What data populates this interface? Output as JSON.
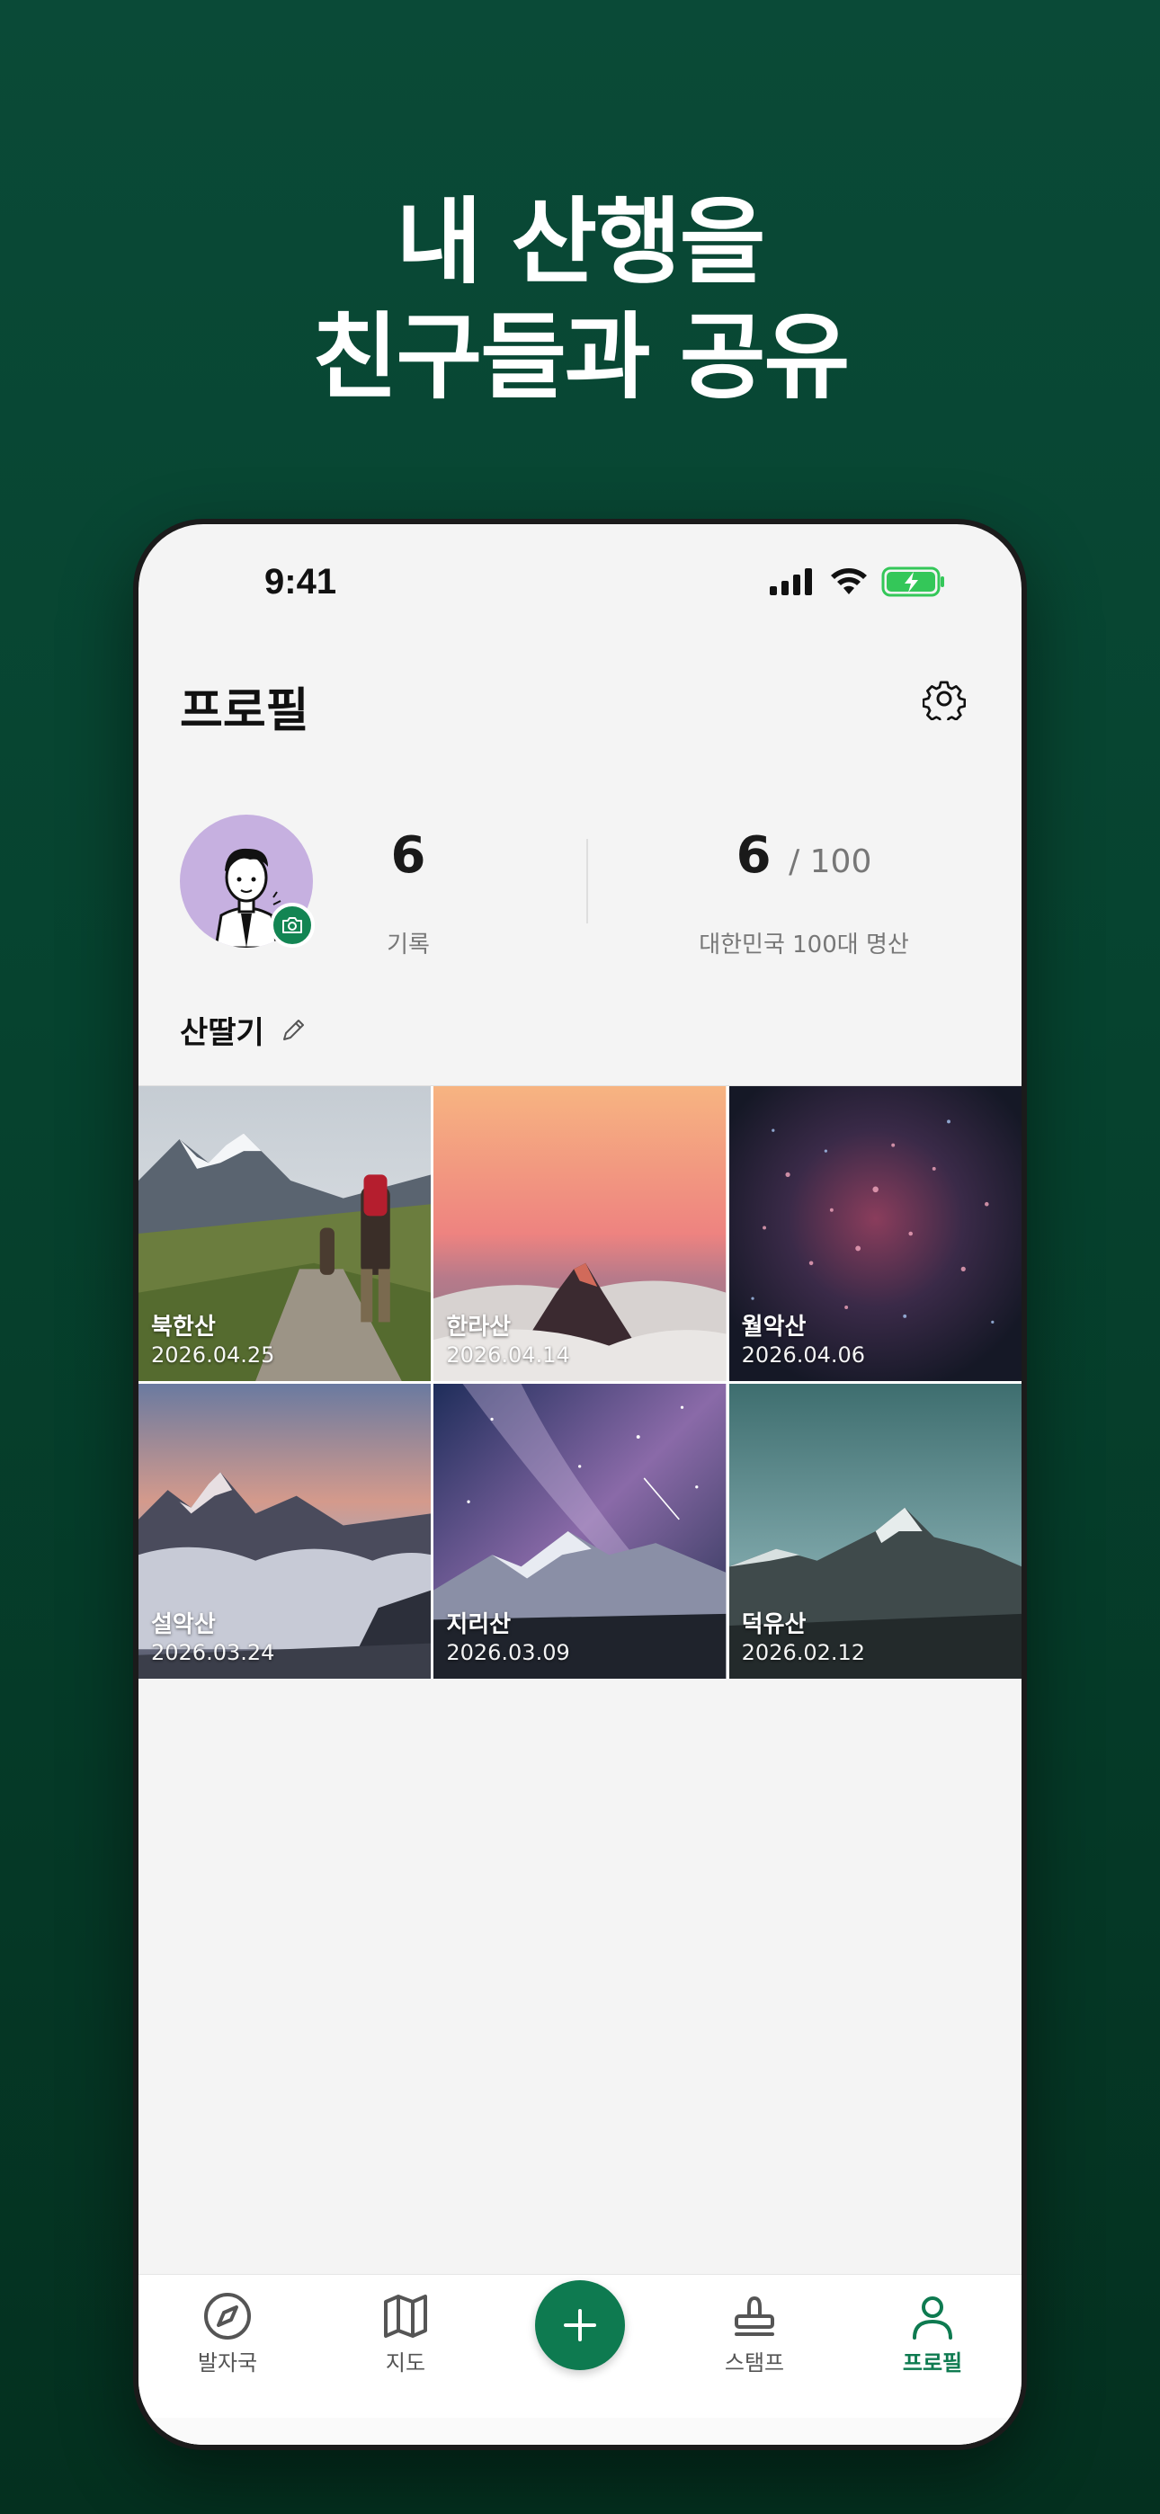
{
  "headline": {
    "line1": "내 산행을",
    "line2": "친구들과 공유"
  },
  "status_bar": {
    "time": "9:41"
  },
  "header": {
    "title": "프로필"
  },
  "profile": {
    "nickname": "산딸기",
    "records_count": "6",
    "records_label": "기록",
    "mountains_count": "6",
    "mountains_total": "/ 100",
    "mountains_label": "대한민국 100대 명산"
  },
  "gallery": [
    {
      "name": "북한산",
      "date": "2026.04.25"
    },
    {
      "name": "한라산",
      "date": "2026.04.14"
    },
    {
      "name": "월악산",
      "date": "2026.04.06"
    },
    {
      "name": "설악산",
      "date": "2026.03.24"
    },
    {
      "name": "지리산",
      "date": "2026.03.09"
    },
    {
      "name": "덕유산",
      "date": "2026.02.12"
    }
  ],
  "tabs": [
    {
      "label": "발자국",
      "icon": "compass-icon"
    },
    {
      "label": "지도",
      "icon": "map-icon"
    },
    {
      "label": "",
      "icon": "plus-icon"
    },
    {
      "label": "스탬프",
      "icon": "stamp-icon"
    },
    {
      "label": "프로필",
      "icon": "person-icon"
    }
  ],
  "active_tab": "프로필",
  "colors": {
    "brand_green": "#0e7a50",
    "background": "#064a34"
  }
}
